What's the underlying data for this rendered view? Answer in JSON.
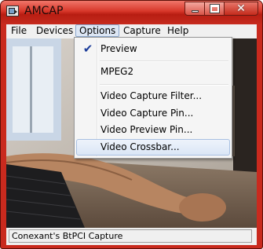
{
  "window": {
    "title": "AMCAP"
  },
  "menubar": {
    "items": [
      "File",
      "Devices",
      "Options",
      "Capture",
      "Help"
    ],
    "active": "Options"
  },
  "options_menu": {
    "items": [
      {
        "label": "Preview",
        "checked": true
      },
      {
        "label": "MPEG2",
        "checked": false
      },
      {
        "label": "Video Capture Filter...",
        "checked": false
      },
      {
        "label": "Video Capture Pin...",
        "checked": false
      },
      {
        "label": "Video Preview Pin...",
        "checked": false
      },
      {
        "label": "Video Crossbar...",
        "checked": false,
        "highlighted": true
      }
    ]
  },
  "statusbar": {
    "text": "Conexant's BtPCI Capture"
  },
  "colors": {
    "frame": "#c92a1e",
    "menu_highlight": "#dce6f4",
    "check": "#1c3d9a"
  },
  "icons": {
    "app": "camera-app-icon",
    "minimize": "minimize-icon",
    "maximize": "maximize-icon",
    "close": "close-icon",
    "check": "checkmark-icon"
  }
}
